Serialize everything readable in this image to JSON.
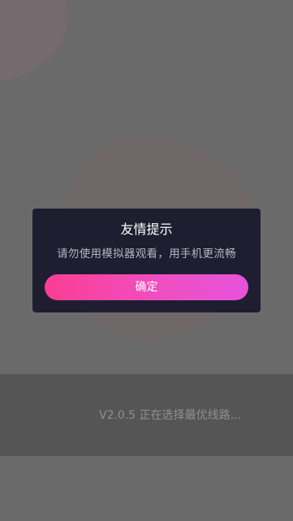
{
  "dialog": {
    "title": "友情提示",
    "message": "请勿使用模拟器观看，用手机更流畅",
    "confirm_label": "确定"
  },
  "loading": {
    "status_text": "V2.0.5 正在选择最优线路..."
  },
  "colors": {
    "dialog_background": "#1e1e30",
    "button_gradient_start": "#fb3d94",
    "button_gradient_end": "#e553db"
  }
}
